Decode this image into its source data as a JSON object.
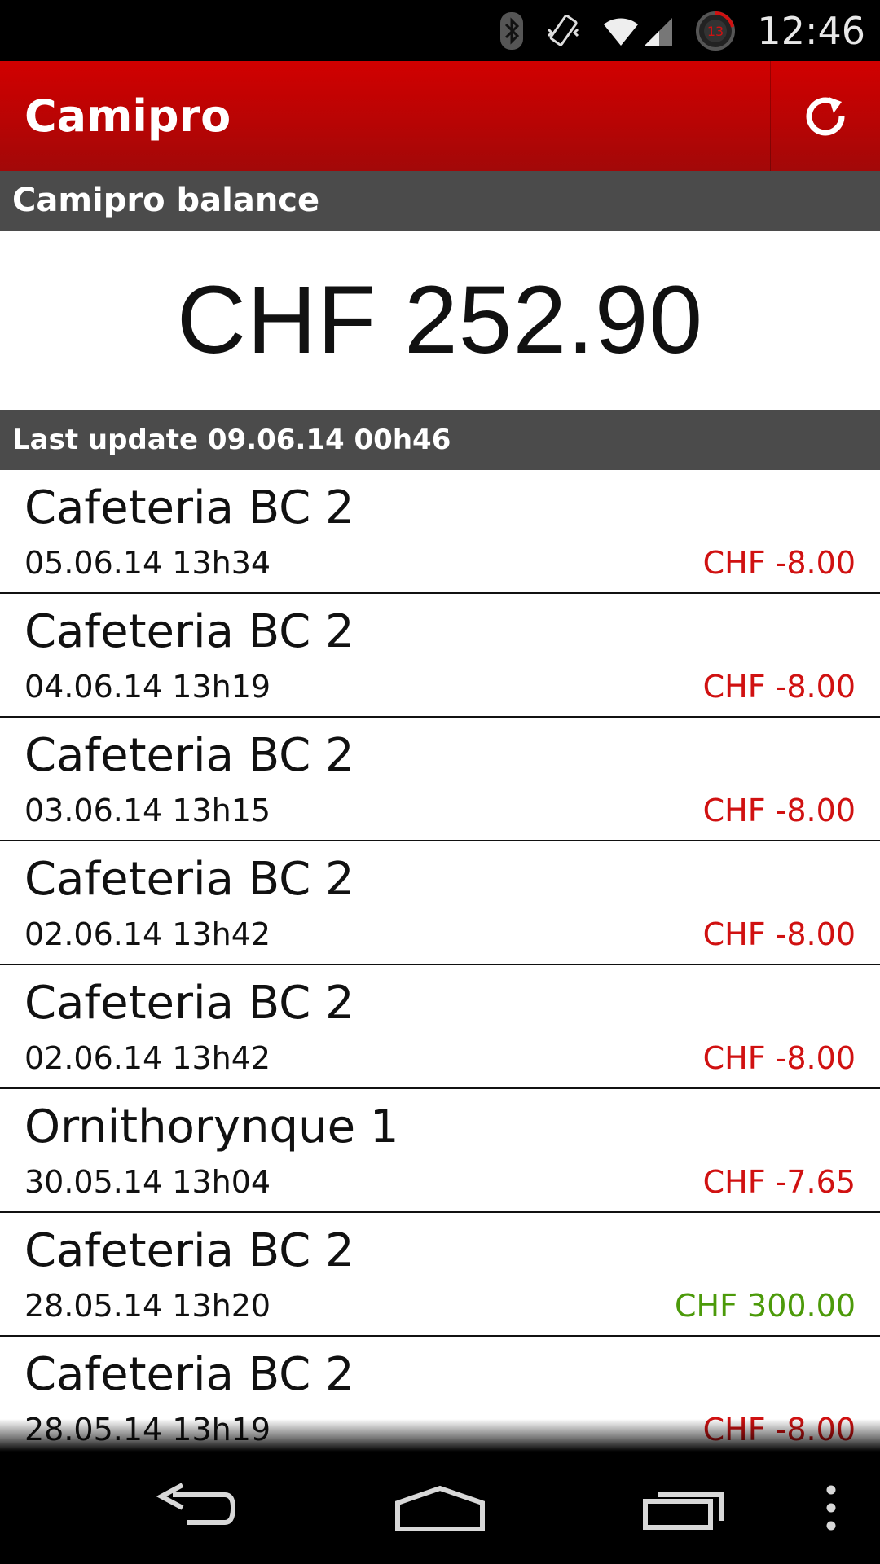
{
  "status_bar": {
    "time": "12:46",
    "notification_count": "13",
    "icons": [
      "bluetooth-icon",
      "vibrate-icon",
      "wifi-icon",
      "signal-icon",
      "notification-counter-icon"
    ]
  },
  "action_bar": {
    "title": "Camipro",
    "refresh_icon": "refresh-icon"
  },
  "balance": {
    "header": "Camipro balance",
    "value": "CHF 252.90"
  },
  "last_update": "Last update 09.06.14 00h46",
  "transactions": [
    {
      "name": "Cafeteria BC 2",
      "date": "05.06.14 13h34",
      "amount": "CHF -8.00",
      "type": "debit"
    },
    {
      "name": "Cafeteria BC 2",
      "date": "04.06.14 13h19",
      "amount": "CHF -8.00",
      "type": "debit"
    },
    {
      "name": "Cafeteria BC 2",
      "date": "03.06.14 13h15",
      "amount": "CHF -8.00",
      "type": "debit"
    },
    {
      "name": "Cafeteria BC 2",
      "date": "02.06.14 13h42",
      "amount": "CHF -8.00",
      "type": "debit"
    },
    {
      "name": "Cafeteria BC 2",
      "date": "02.06.14 13h42",
      "amount": "CHF -8.00",
      "type": "debit"
    },
    {
      "name": "Ornithorynque 1",
      "date": "30.05.14 13h04",
      "amount": "CHF -7.65",
      "type": "debit"
    },
    {
      "name": "Cafeteria BC 2",
      "date": "28.05.14 13h20",
      "amount": "CHF 300.00",
      "type": "credit"
    },
    {
      "name": "Cafeteria BC 2",
      "date": "28.05.14 13h19",
      "amount": "CHF -8.00",
      "type": "debit"
    }
  ],
  "colors": {
    "action_bar": "#c00000",
    "section_header": "#4b4b4b",
    "debit": "#d01111",
    "credit": "#4c9a0a"
  },
  "nav_bar": {
    "icons": [
      "back-icon",
      "home-icon",
      "recents-icon",
      "overflow-menu-icon"
    ]
  }
}
